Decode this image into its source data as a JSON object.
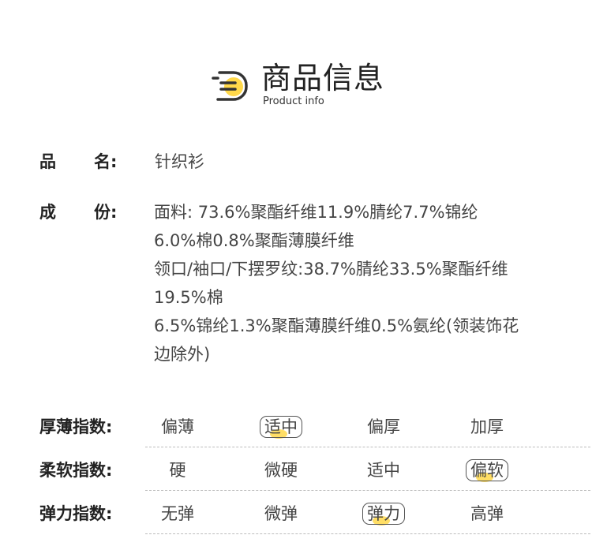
{
  "header": {
    "title_cn": "商品信息",
    "title_en": "Product info",
    "accent_color": "#ffd84a"
  },
  "product": {
    "name_label_a": "品",
    "name_label_b": "名:",
    "name_value": "针织衫",
    "composition_label_a": "成",
    "composition_label_b": "份:",
    "composition_lines": [
      "面料: 73.6%聚酯纤维11.9%腈纶7.7%锦纶",
      "6.0%棉0.8%聚酯薄膜纤维",
      "领口/袖口/下摆罗纹:38.7%腈纶33.5%聚酯纤维",
      "19.5%棉",
      "6.5%锦纶1.3%聚酯薄膜纤维0.5%氨纶(领装饰花",
      "边除外)"
    ]
  },
  "indices": [
    {
      "label": "厚薄指数:",
      "options": [
        "偏薄",
        "适中",
        "偏厚",
        "加厚"
      ],
      "selected": 1
    },
    {
      "label": "柔软指数:",
      "options": [
        "硬",
        "微硬",
        "适中",
        "偏软"
      ],
      "selected": 3
    },
    {
      "label": "弹力指数:",
      "options": [
        "无弹",
        "微弹",
        "弹力",
        "高弹"
      ],
      "selected": 2
    }
  ]
}
